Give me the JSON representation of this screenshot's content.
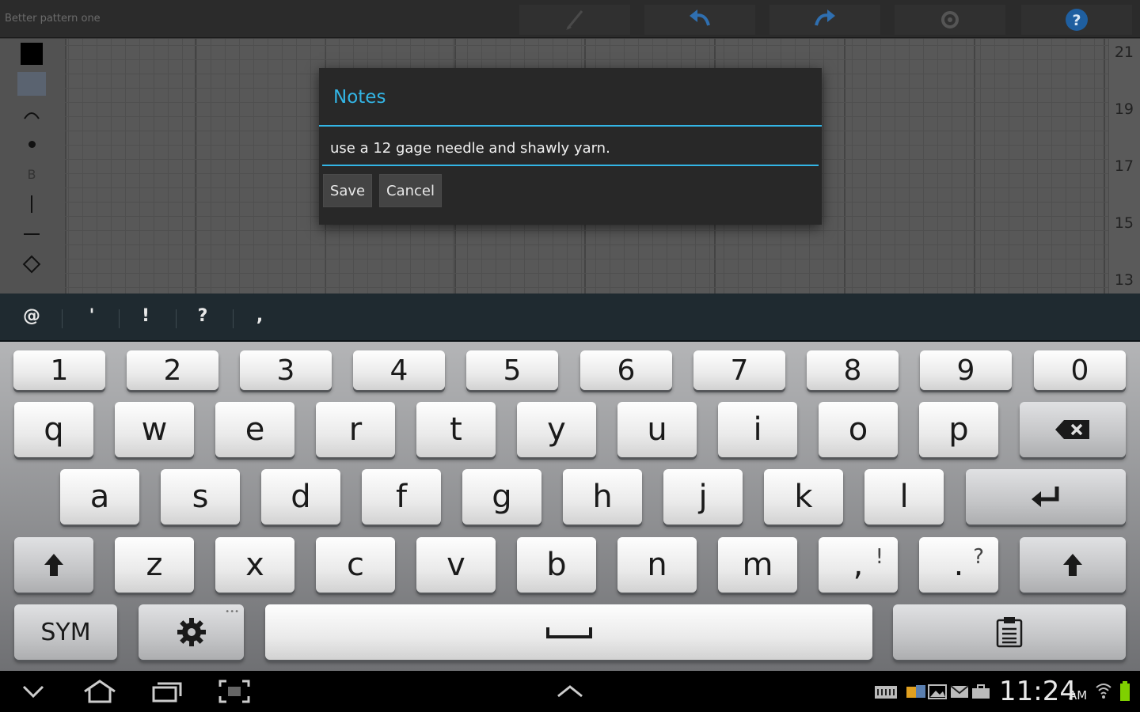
{
  "app": {
    "title": "Better pattern one"
  },
  "toolbar": {
    "items": [
      {
        "name": "brush",
        "icon": "brush-icon"
      },
      {
        "name": "undo",
        "icon": "undo-icon"
      },
      {
        "name": "redo",
        "icon": "redo-icon"
      },
      {
        "name": "settings",
        "icon": "gear-icon"
      },
      {
        "name": "help",
        "icon": "help-icon"
      }
    ]
  },
  "tools": {
    "items": [
      "black-swatch",
      "blue-swatch",
      "arc-icon",
      "dot-icon",
      "b-symbol",
      "vertical-line-icon",
      "horizontal-line-icon",
      "diamond-icon"
    ],
    "b_label": "B"
  },
  "grid": {
    "row_numbers": [
      "21",
      "19",
      "17",
      "15",
      "13"
    ]
  },
  "dialog": {
    "title": "Notes",
    "note_value": "use a 12 gage needle and shawly yarn.",
    "save_label": "Save",
    "cancel_label": "Cancel"
  },
  "suggestions": [
    "@",
    "'",
    "!",
    "?",
    ","
  ],
  "keyboard": {
    "number_row": [
      "1",
      "2",
      "3",
      "4",
      "5",
      "6",
      "7",
      "8",
      "9",
      "0"
    ],
    "row1": [
      "q",
      "w",
      "e",
      "r",
      "t",
      "y",
      "u",
      "i",
      "o",
      "p"
    ],
    "row2": [
      "a",
      "s",
      "d",
      "f",
      "g",
      "h",
      "j",
      "k",
      "l"
    ],
    "row3": [
      "z",
      "x",
      "c",
      "v",
      "b",
      "n",
      "m"
    ],
    "comma_key": {
      "main": ",",
      "alt": "!"
    },
    "period_key": {
      "main": ".",
      "alt": "?"
    },
    "sym_label": "SYM"
  },
  "status": {
    "time": "11:24",
    "ampm": "AM"
  },
  "colors": {
    "accent": "#33b5e5",
    "help": "#33b5e5",
    "battery": "#7fd000"
  }
}
